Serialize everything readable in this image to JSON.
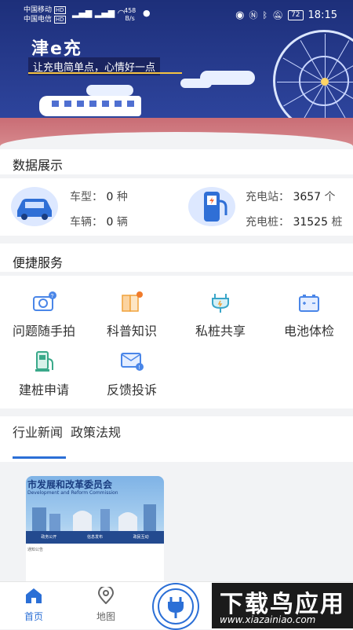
{
  "status_bar": {
    "carrier1": "中国移动",
    "carrier1_tag": "HD",
    "carrier2": "中国电信",
    "carrier2_tag": "HD",
    "net_speed": "458",
    "net_unit": "B/s",
    "battery": "72",
    "time": "18:15"
  },
  "banner": {
    "brand": "津e充",
    "slogan": "让充电简单点，心情好一点"
  },
  "data_display": {
    "title": "数据展示",
    "car_model_label": "车型：",
    "car_model_value": "0",
    "car_model_unit": "种",
    "vehicle_label": "车辆：",
    "vehicle_value": "0",
    "vehicle_unit": "辆",
    "station_label": "充电站：",
    "station_value": "3657",
    "station_unit": "个",
    "pile_label": "充电桩：",
    "pile_value": "31525",
    "pile_unit": "桩"
  },
  "quick_services": {
    "title": "便捷服务",
    "items": [
      {
        "label": "问题随手拍",
        "icon": "camera-icon",
        "color": "#4a86e8"
      },
      {
        "label": "科普知识",
        "icon": "book-icon",
        "color": "#f0a23b"
      },
      {
        "label": "私桩共享",
        "icon": "plug-share-icon",
        "color": "#3aa6c9"
      },
      {
        "label": "电池体检",
        "icon": "battery-icon",
        "color": "#4a86e8"
      },
      {
        "label": "建桩申请",
        "icon": "charger-apply-icon",
        "color": "#3aa98a"
      },
      {
        "label": "反馈投诉",
        "icon": "feedback-icon",
        "color": "#4a86e8"
      }
    ]
  },
  "news": {
    "tabs": [
      {
        "label": "行业新闻",
        "active": true
      },
      {
        "label": "政策法规",
        "active": false
      }
    ],
    "card": {
      "title": "市发展和改革委员会",
      "subtitle": "Development and Reform Commission",
      "nav": [
        "政务公开",
        "信息发布",
        "政民互动"
      ],
      "line": "通知公告"
    }
  },
  "bottom_nav": {
    "home": "首页",
    "map": "地图"
  },
  "watermark": {
    "main": "下载鸟应用",
    "url": "www.xiazainiao.com"
  },
  "colors": {
    "accent": "#2b6fd6",
    "banner": "#1d2f7a"
  }
}
